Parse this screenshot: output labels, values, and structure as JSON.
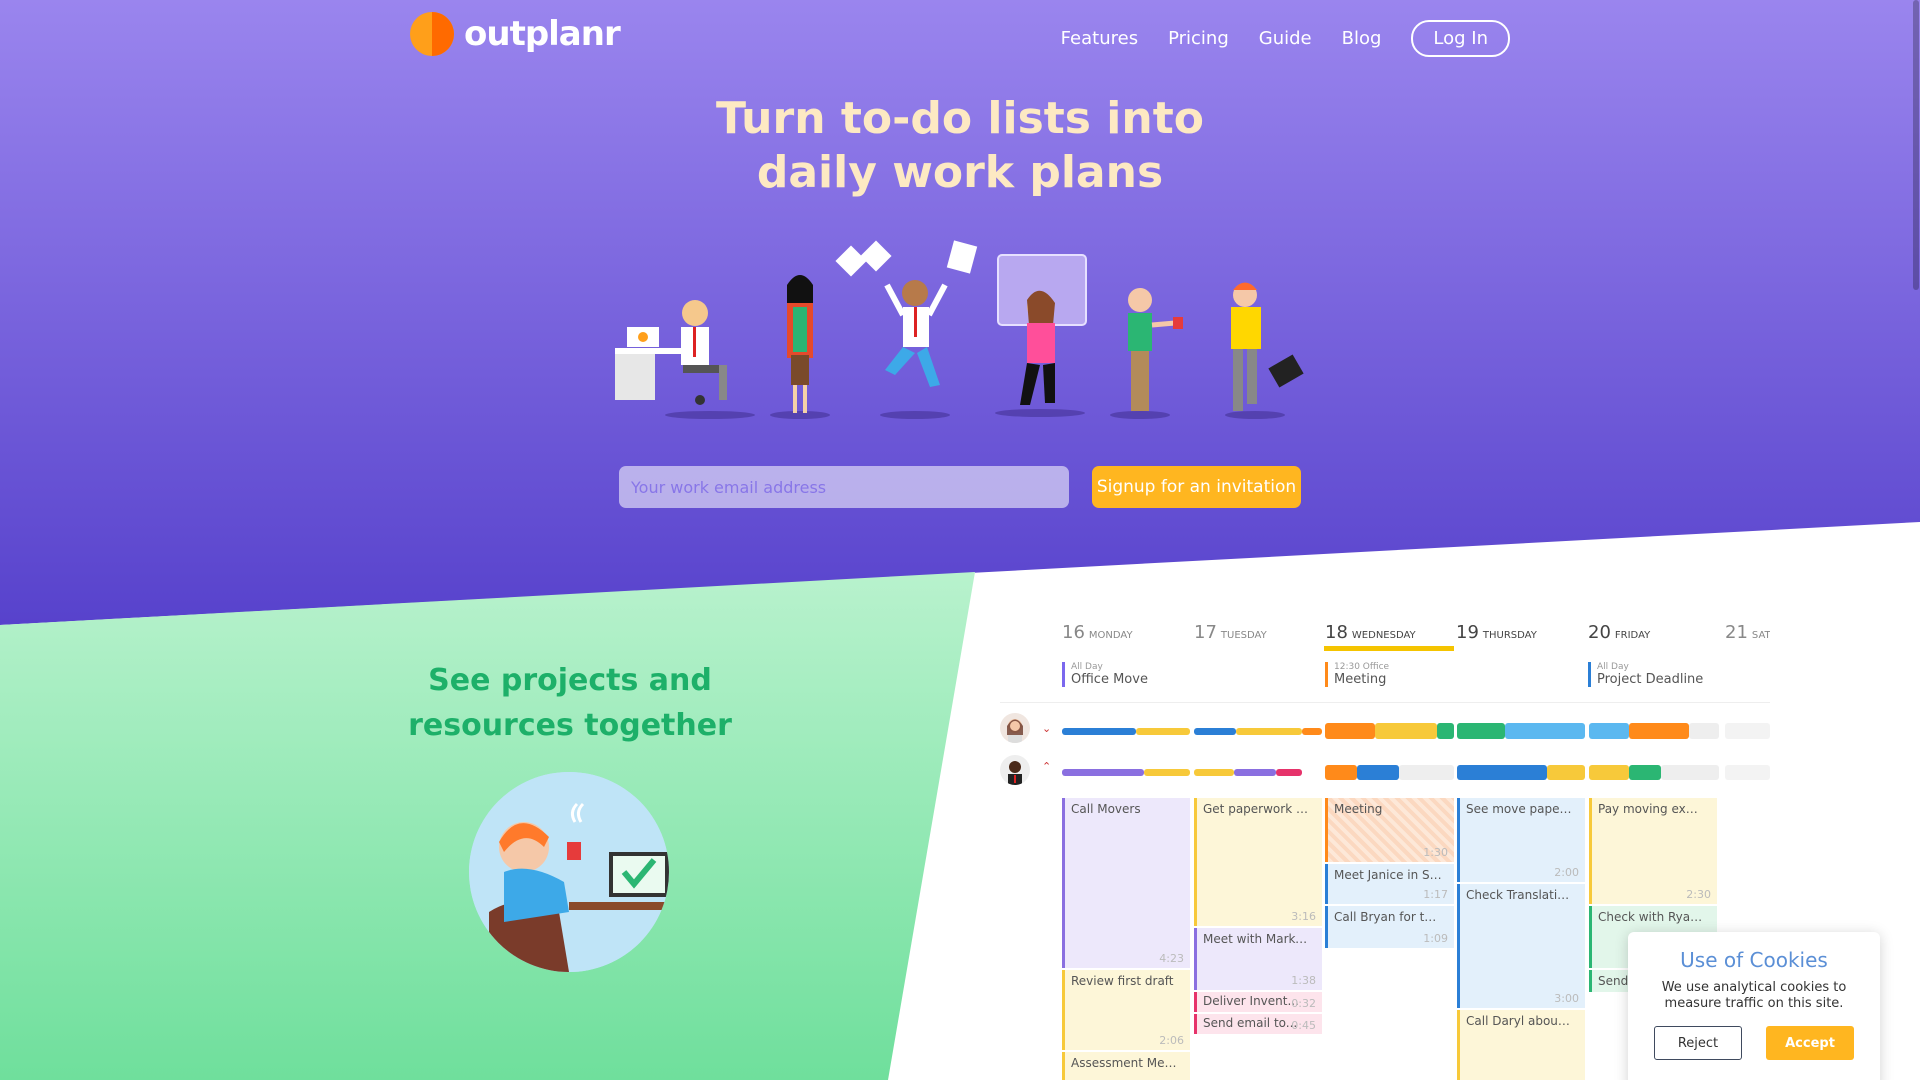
{
  "brand": {
    "name": "outplanr"
  },
  "nav": {
    "items": [
      "Features",
      "Pricing",
      "Guide",
      "Blog"
    ],
    "login": "Log In"
  },
  "hero": {
    "title_line1": "Turn to-do lists into",
    "title_line2": "daily work plans",
    "email_placeholder": "Your work email address",
    "signup_label": "Signup for an invitation"
  },
  "section": {
    "title_line1": "See projects and",
    "title_line2": "resources together"
  },
  "calendar": {
    "days": [
      {
        "num": "16",
        "name": "Monday"
      },
      {
        "num": "17",
        "name": "Tuesday"
      },
      {
        "num": "18",
        "name": "Wednesday"
      },
      {
        "num": "19",
        "name": "Thursday"
      },
      {
        "num": "20",
        "name": "Friday"
      },
      {
        "num": "21",
        "name": "Sat"
      }
    ],
    "allday": [
      {
        "time": "All Day",
        "name": "Office Move"
      },
      {
        "time": "12:30 Office",
        "name": "Meeting"
      },
      {
        "time": "All Day",
        "name": "Project Deadline"
      }
    ],
    "tasks": [
      {
        "label": "Call Movers",
        "dur": "4:23"
      },
      {
        "label": "Review first draft",
        "dur": "2:06"
      },
      {
        "label": "Assessment Meeti...",
        "dur": ""
      },
      {
        "label": "Get paperwork re...",
        "dur": "3:16"
      },
      {
        "label": "Meet with Marketi...",
        "dur": "1:38"
      },
      {
        "label": "Deliver Invent...",
        "dur": "0:32"
      },
      {
        "label": "Send email to...",
        "dur": "0:45"
      },
      {
        "label": "Meeting",
        "dur": "1:30"
      },
      {
        "label": "Meet Janice in Sky...",
        "dur": "1:17"
      },
      {
        "label": "Call Bryan for the ...",
        "dur": "1:09"
      },
      {
        "label": "See move paperwo...",
        "dur": "2:00"
      },
      {
        "label": "Check Translations",
        "dur": "3:00"
      },
      {
        "label": "Call Daryl about th...",
        "dur": ""
      },
      {
        "label": "Pay moving expen...",
        "dur": "2:30"
      },
      {
        "label": "Check with Ryan t...",
        "dur": ""
      },
      {
        "label": "Send",
        "dur": ""
      }
    ]
  },
  "cookies": {
    "title": "Use of Cookies",
    "text": "We use analytical cookies to measure traffic on this site.",
    "reject": "Reject",
    "accept": "Accept"
  },
  "colors": {
    "purple_top": "#9a85ee",
    "purple_bottom": "#5b45cf",
    "green": "#7ee4a6",
    "accent": "#ffb620",
    "title_text": "#fde9c3"
  }
}
